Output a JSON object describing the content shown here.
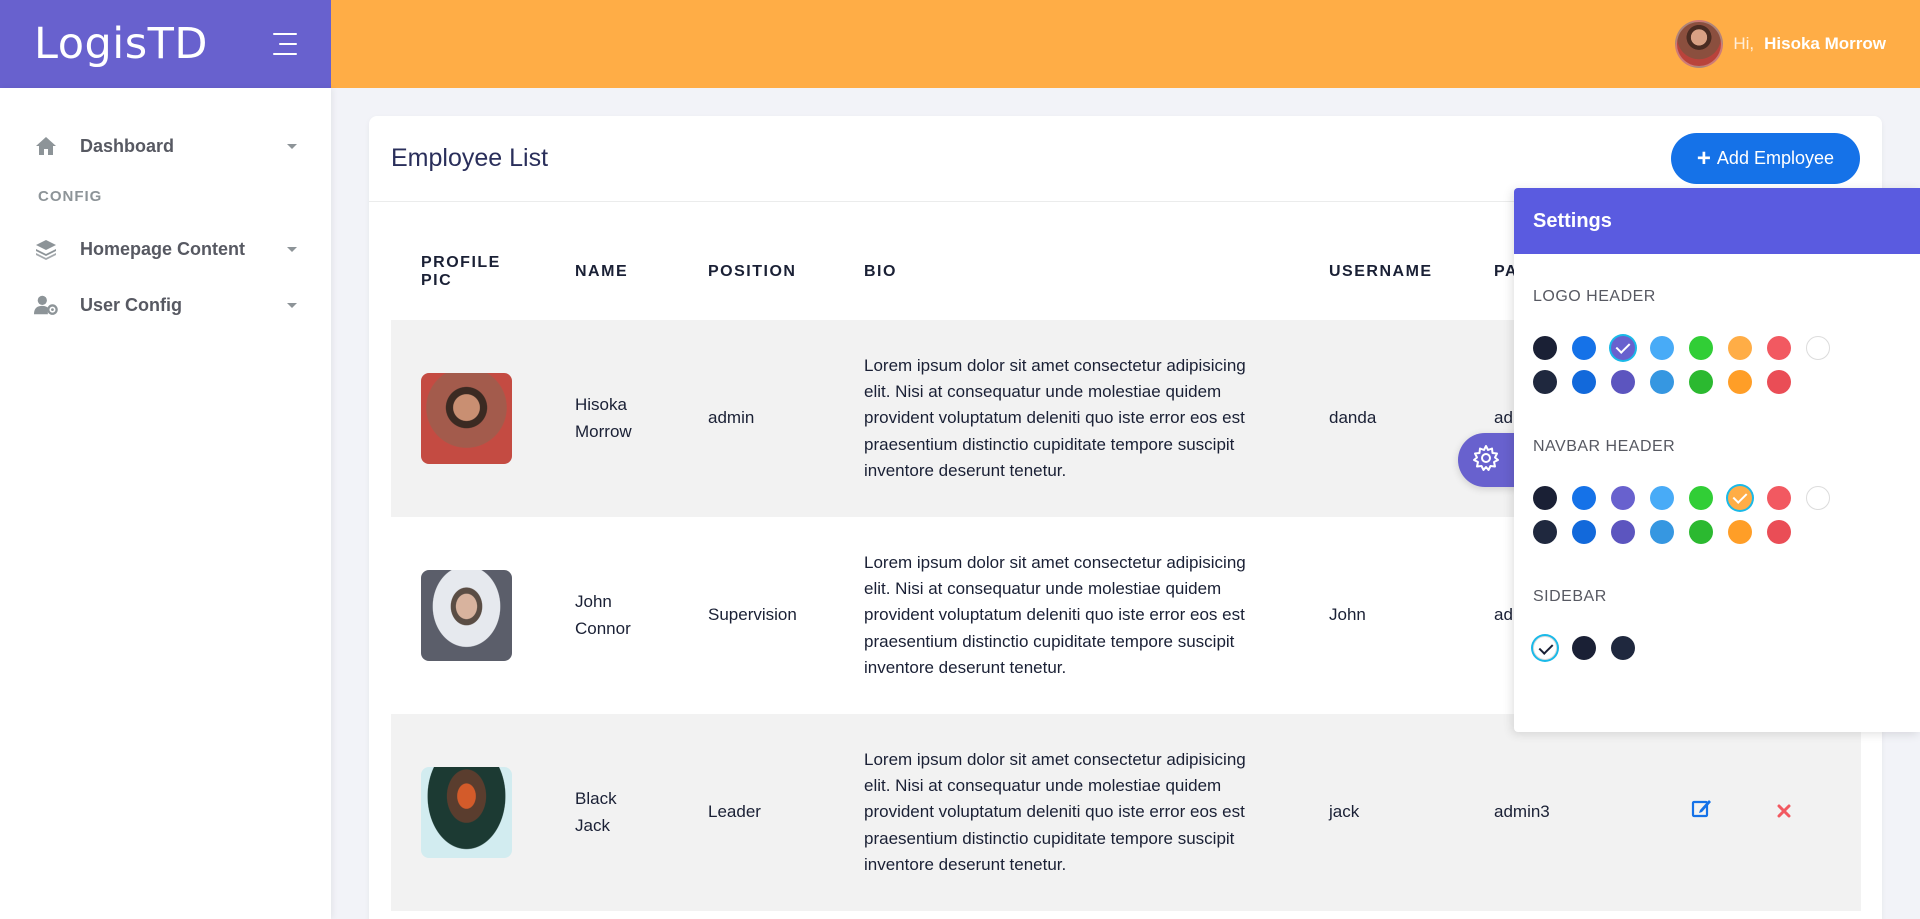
{
  "brand": {
    "name": "LogisTD"
  },
  "user": {
    "greeting": "Hi,",
    "name": "Hisoka Morrow"
  },
  "sidebar": {
    "items": [
      {
        "label": "Dashboard",
        "icon": "home-icon"
      }
    ],
    "section": "CONFIG",
    "config_items": [
      {
        "label": "Homepage Content",
        "icon": "layers-icon"
      },
      {
        "label": "User Config",
        "icon": "user-gear-icon"
      }
    ]
  },
  "main": {
    "title": "Employee List",
    "add_button": "Add Employee",
    "columns": [
      "PROFILE PIC",
      "NAME",
      "POSITION",
      "BIO",
      "USERNAME",
      "PA"
    ],
    "rows": [
      {
        "name": "Hisoka Morrow",
        "position": "admin",
        "bio": "Lorem ipsum dolor sit amet consectetur adipisicing elit. Nisi at consequatur unde molestiae quidem provident voluptatum deleniti quo iste error eos est praesentium distinctio cupiditate tempore suscipit inventore deserunt tenetur.",
        "username": "danda",
        "password": "ad"
      },
      {
        "name": "John Connor",
        "position": "Supervision",
        "bio": "Lorem ipsum dolor sit amet consectetur adipisicing elit. Nisi at consequatur unde molestiae quidem provident voluptatum deleniti quo iste error eos est praesentium distinctio cupiditate tempore suscipit inventore deserunt tenetur.",
        "username": "John",
        "password": "ad"
      },
      {
        "name": "Black Jack",
        "position": "Leader",
        "bio": "Lorem ipsum dolor sit amet consectetur adipisicing elit. Nisi at consequatur unde molestiae quidem provident voluptatum deleniti quo iste error eos est praesentium distinctio cupiditate tempore suscipit inventore deserunt tenetur.",
        "username": "jack",
        "password": "admin3"
      }
    ]
  },
  "settings": {
    "title": "Settings",
    "logo_header": {
      "label": "LOGO HEADER",
      "row1": [
        "#1a2035",
        "#1572e8",
        "#6861ce",
        "#48abf7",
        "#31ce36",
        "#ffad46",
        "#f25961",
        "#ffffff"
      ],
      "row2": [
        "#1f283e",
        "#1269db",
        "#5c55bf",
        "#3697e1",
        "#2bb930",
        "#ff9e27",
        "#ea4d56"
      ],
      "selected": 2
    },
    "navbar_header": {
      "label": "NAVBAR HEADER",
      "row1": [
        "#1a2035",
        "#1572e8",
        "#6861ce",
        "#48abf7",
        "#31ce36",
        "#ffad46",
        "#f25961",
        "#ffffff"
      ],
      "row2": [
        "#1f283e",
        "#1269db",
        "#5c55bf",
        "#3697e1",
        "#2bb930",
        "#ff9e27",
        "#ea4d56"
      ],
      "selected": 5
    },
    "sidebar": {
      "label": "SIDEBAR",
      "row1": [
        "#ffffff",
        "#1a2035",
        "#1f283e"
      ],
      "selected": 0
    }
  },
  "colors": {
    "logo_header": "#6861ce",
    "navbar": "#ffad46",
    "primary": "#1572e8",
    "danger": "#f25961"
  }
}
